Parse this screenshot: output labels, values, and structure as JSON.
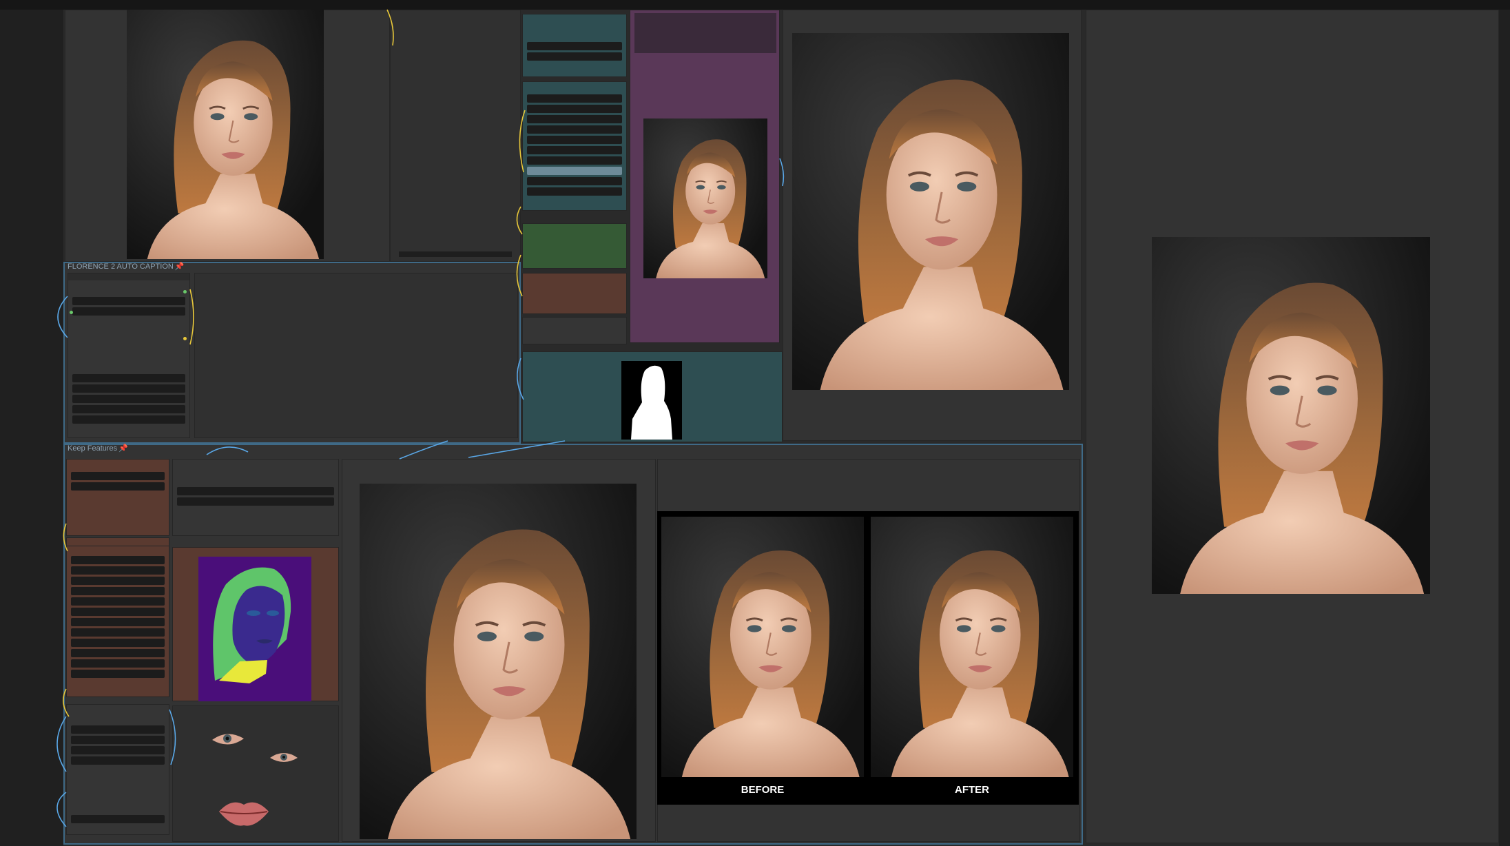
{
  "groups": {
    "florence_caption": {
      "title": "FLORENCE 2 AUTO CAPTION"
    },
    "keep_features": {
      "title": "Keep Features"
    }
  },
  "comparison": {
    "before_label": "BEFORE",
    "after_label": "AFTER"
  },
  "colors": {
    "canvas": "#2a2a2a",
    "group_border": "#3f6a87",
    "node_purple": "#5a3858",
    "node_green": "#355a35",
    "node_brown": "#5a3a30",
    "node_teal": "#2e4e52",
    "segmentation_bg": "#4a0e7a",
    "segmentation_hair": "#5fc56a",
    "segmentation_face": "#3a2a8e",
    "segmentation_neck": "#e8e83a",
    "wire_blue": "#5aa8e8",
    "wire_yellow": "#e8c83a"
  },
  "icons": {
    "pin": "pin-icon"
  }
}
